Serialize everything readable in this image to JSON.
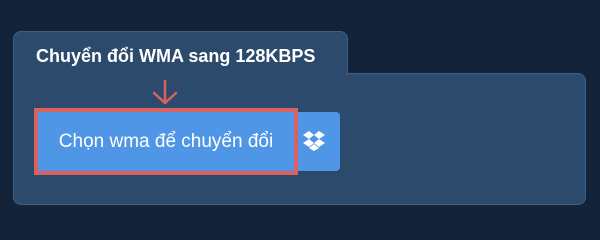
{
  "panel": {
    "tab_title": "Chuyển đổi WMA sang 128KBPS"
  },
  "upload": {
    "choose_label": "Chọn wma để chuyển đổi",
    "cloud_icon": "dropbox-icon"
  },
  "colors": {
    "background": "#12233a",
    "panel": "#2c4a6c",
    "button": "#4f96e6",
    "highlight": "#d9625f"
  }
}
